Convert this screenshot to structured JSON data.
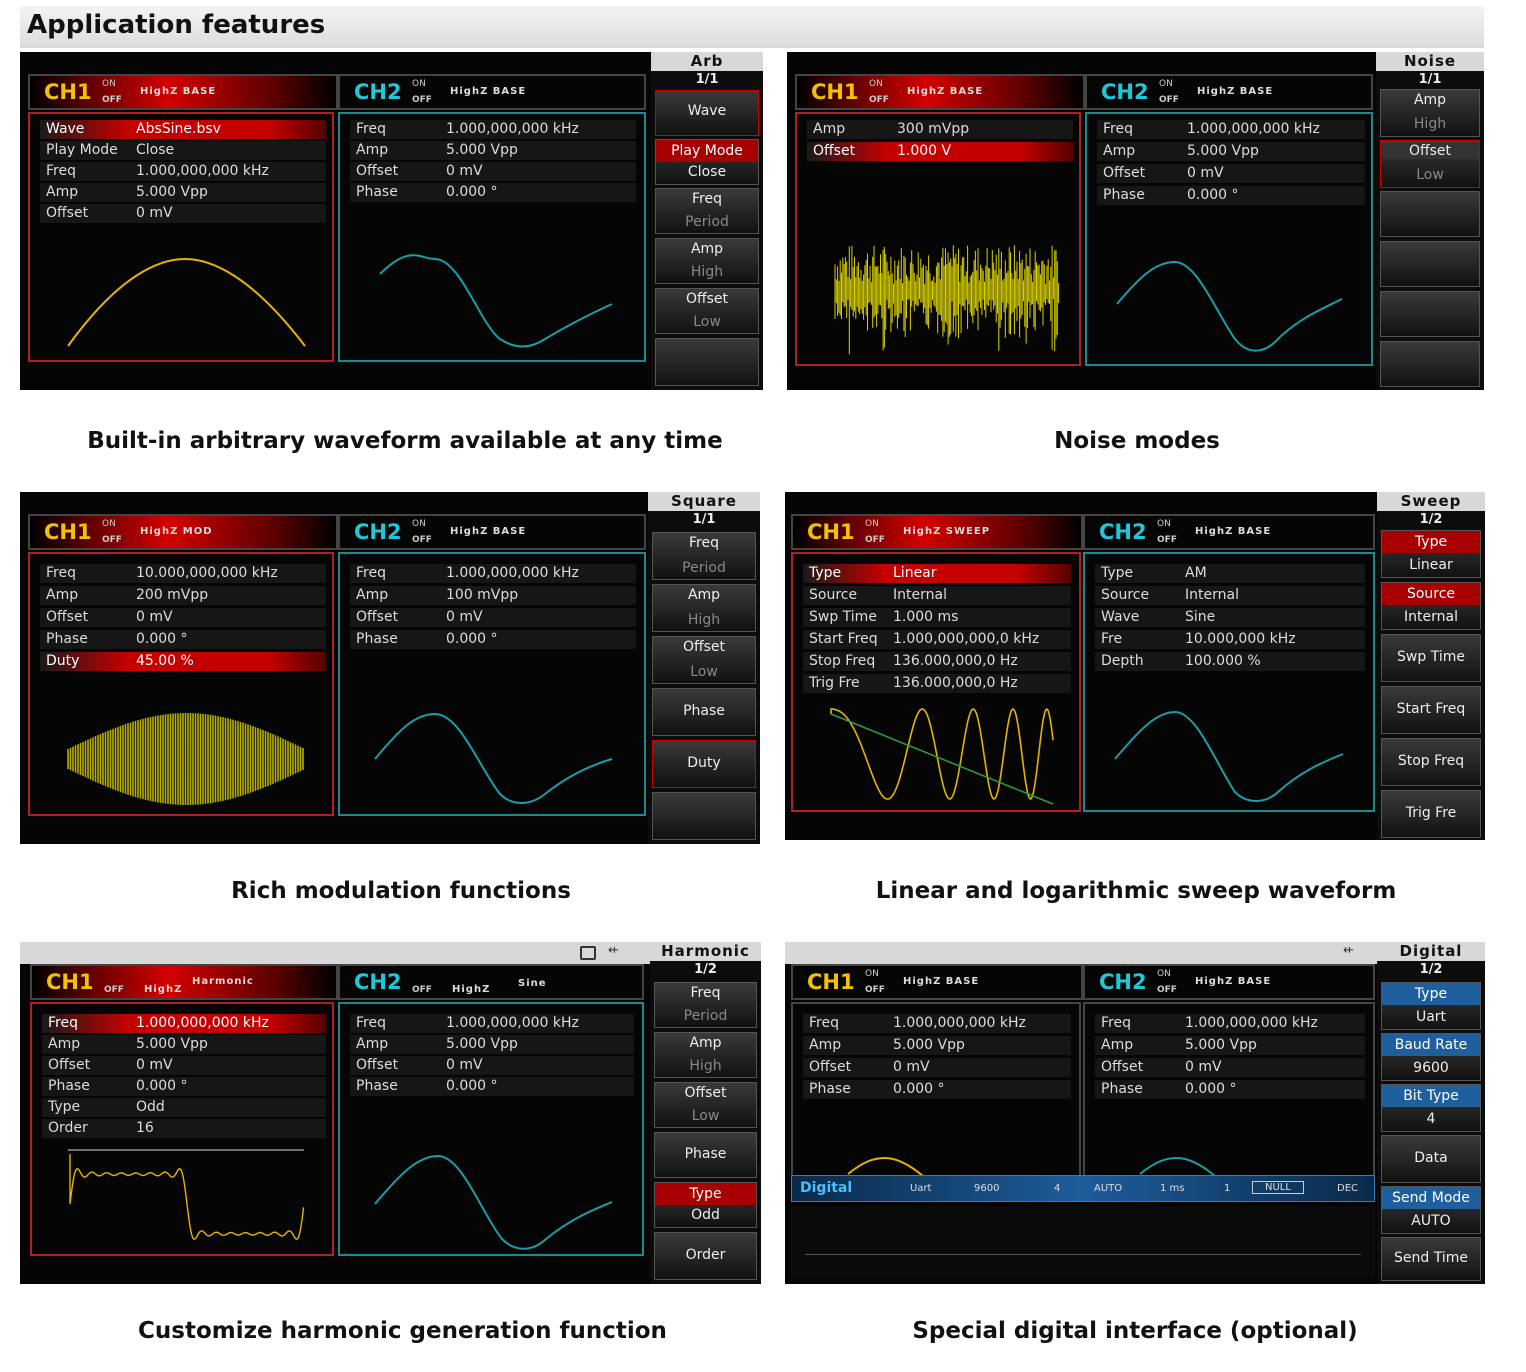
{
  "header": {
    "title": "Application features"
  },
  "captions": [
    "Built-in arbitrary waveform available at any time",
    "Noise modes",
    "Rich modulation functions",
    "Linear and logarithmic sweep waveform",
    "Customize harmonic generation function",
    "Special digital interface (optional)"
  ],
  "colors": {
    "ch1": "#f2c200",
    "ch2": "#1ec8d8",
    "active": "#c40000",
    "teal": "#1a8a8f"
  },
  "screens": [
    {
      "ch1": {
        "name": "CH1",
        "on": "ON",
        "off": "OFF",
        "mode": "HighZ BASE",
        "rows": [
          {
            "k": "Wave",
            "v": "AbsSine.bsv"
          },
          {
            "k": "Play Mode",
            "v": "Close"
          },
          {
            "k": "Freq",
            "v": "1.000,000,000 kHz"
          },
          {
            "k": "Amp",
            "v": "5.000 Vpp"
          },
          {
            "k": "Offset",
            "v": "0 mV"
          }
        ]
      },
      "ch2": {
        "name": "CH2",
        "on": "ON",
        "off": "OFF",
        "mode": "HighZ BASE",
        "rows": [
          {
            "k": "Freq",
            "v": "1.000,000,000 kHz"
          },
          {
            "k": "Amp",
            "v": "5.000 Vpp"
          },
          {
            "k": "Offset",
            "v": "0 mV"
          },
          {
            "k": "Phase",
            "v": "0.000 °"
          }
        ]
      },
      "menu": {
        "title": "Arb",
        "page": "1/1",
        "buttons": [
          {
            "a": "Wave"
          },
          {
            "a": "Play Mode",
            "b": "Close"
          },
          {
            "a": "Freq",
            "b": "Period"
          },
          {
            "a": "Amp",
            "b": "High"
          },
          {
            "a": "Offset",
            "b": "Low"
          },
          {
            "a": ""
          }
        ]
      }
    },
    {
      "ch1": {
        "name": "CH1",
        "on": "ON",
        "off": "OFF",
        "mode": "HighZ BASE",
        "rows": [
          {
            "k": "Amp",
            "v": "300 mVpp"
          },
          {
            "k": "Offset",
            "v": "1.000 V"
          }
        ]
      },
      "ch2": {
        "name": "CH2",
        "on": "ON",
        "off": "OFF",
        "mode": "HighZ BASE",
        "rows": [
          {
            "k": "Freq",
            "v": "1.000,000,000 kHz"
          },
          {
            "k": "Amp",
            "v": "5.000 Vpp"
          },
          {
            "k": "Offset",
            "v": "0 mV"
          },
          {
            "k": "Phase",
            "v": "0.000 °"
          }
        ]
      },
      "menu": {
        "title": "Noise",
        "page": "1/1",
        "buttons": [
          {
            "a": "Amp",
            "b": "High"
          },
          {
            "a": "Offset",
            "b": "Low"
          },
          {
            "a": ""
          },
          {
            "a": ""
          },
          {
            "a": ""
          },
          {
            "a": ""
          }
        ]
      }
    },
    {
      "ch1": {
        "name": "CH1",
        "on": "ON",
        "off": "OFF",
        "mode": "HighZ MOD",
        "rows": [
          {
            "k": "Freq",
            "v": "10.000,000,000 kHz"
          },
          {
            "k": "Amp",
            "v": "200 mVpp"
          },
          {
            "k": "Offset",
            "v": "0 mV"
          },
          {
            "k": "Phase",
            "v": "0.000 °"
          },
          {
            "k": "Duty",
            "v": "45.00 %"
          }
        ]
      },
      "ch2": {
        "name": "CH2",
        "on": "ON",
        "off": "OFF",
        "mode": "HighZ BASE",
        "rows": [
          {
            "k": "Freq",
            "v": "1.000,000,000 kHz"
          },
          {
            "k": "Amp",
            "v": "100 mVpp"
          },
          {
            "k": "Offset",
            "v": "0 mV"
          },
          {
            "k": "Phase",
            "v": "0.000 °"
          }
        ]
      },
      "menu": {
        "title": "Square",
        "page": "1/1",
        "buttons": [
          {
            "a": "Freq",
            "b": "Period"
          },
          {
            "a": "Amp",
            "b": "High"
          },
          {
            "a": "Offset",
            "b": "Low"
          },
          {
            "a": "Phase"
          },
          {
            "a": "Duty"
          },
          {
            "a": ""
          }
        ]
      }
    },
    {
      "ch1": {
        "name": "CH1",
        "on": "ON",
        "off": "OFF",
        "mode": "HighZ SWEEP",
        "rows": [
          {
            "k": "Type",
            "v": "Linear"
          },
          {
            "k": "Source",
            "v": "Internal"
          },
          {
            "k": "Swp Time",
            "v": "1.000 ms"
          },
          {
            "k": "Start Freq",
            "v": "1.000,000,000,0 kHz"
          },
          {
            "k": "Stop Freq",
            "v": "136.000,000,0 Hz"
          },
          {
            "k": "Trig Fre",
            "v": "136.000,000,0 Hz"
          }
        ]
      },
      "ch2": {
        "name": "CH2",
        "on": "ON",
        "off": "OFF",
        "mode": "HighZ BASE",
        "rows": [
          {
            "k": "Type",
            "v": "AM"
          },
          {
            "k": "Source",
            "v": "Internal"
          },
          {
            "k": "Wave",
            "v": "Sine"
          },
          {
            "k": "Fre",
            "v": "10.000,000 kHz"
          },
          {
            "k": "Depth",
            "v": "100.000 %"
          }
        ]
      },
      "menu": {
        "title": "Sweep",
        "page": "1/2",
        "buttons": [
          {
            "a": "Type",
            "b": "Linear"
          },
          {
            "a": "Source",
            "b": "Internal"
          },
          {
            "a": "Swp Time"
          },
          {
            "a": "Start Freq"
          },
          {
            "a": "Stop Freq"
          },
          {
            "a": "Trig Fre"
          }
        ]
      }
    },
    {
      "ch1": {
        "name": "CH1",
        "on": "",
        "off": "OFF",
        "mode": "HighZ",
        "mode2": "Harmonic",
        "rows": [
          {
            "k": "Freq",
            "v": "1.000,000,000 kHz"
          },
          {
            "k": "Amp",
            "v": "5.000 Vpp"
          },
          {
            "k": "Offset",
            "v": "0 mV"
          },
          {
            "k": "Phase",
            "v": "0.000 °"
          },
          {
            "k": "Type",
            "v": "Odd"
          },
          {
            "k": "Order",
            "v": "16"
          }
        ]
      },
      "ch2": {
        "name": "CH2",
        "on": "",
        "off": "OFF",
        "mode": "HighZ",
        "mode2": "Sine",
        "rows": [
          {
            "k": "Freq",
            "v": "1.000,000,000 kHz"
          },
          {
            "k": "Amp",
            "v": "5.000 Vpp"
          },
          {
            "k": "Offset",
            "v": "0 mV"
          },
          {
            "k": "Phase",
            "v": "0.000 °"
          }
        ]
      },
      "menu": {
        "title": "Harmonic",
        "page": "1/2",
        "buttons": [
          {
            "a": "Freq",
            "b": "Period"
          },
          {
            "a": "Amp",
            "b": "High"
          },
          {
            "a": "Offset",
            "b": "Low"
          },
          {
            "a": "Phase"
          },
          {
            "a": "Type",
            "b": "Odd"
          },
          {
            "a": "Order"
          }
        ]
      }
    },
    {
      "ch1": {
        "name": "CH1",
        "on": "ON",
        "off": "OFF",
        "mode": "HighZ BASE",
        "rows": [
          {
            "k": "Freq",
            "v": "1.000,000,000 kHz"
          },
          {
            "k": "Amp",
            "v": "5.000 Vpp"
          },
          {
            "k": "Offset",
            "v": "0 mV"
          },
          {
            "k": "Phase",
            "v": "0.000 °"
          }
        ]
      },
      "ch2": {
        "name": "CH2",
        "on": "ON",
        "off": "OFF",
        "mode": "HighZ BASE",
        "rows": [
          {
            "k": "Freq",
            "v": "1.000,000,000 kHz"
          },
          {
            "k": "Amp",
            "v": "5.000 Vpp"
          },
          {
            "k": "Offset",
            "v": "0 mV"
          },
          {
            "k": "Phase",
            "v": "0.000 °"
          }
        ]
      },
      "digital_bar": {
        "label": "Digital",
        "fields": [
          "Uart",
          "9600",
          "4",
          "AUTO",
          "1 ms",
          "1",
          "NULL",
          "DEC"
        ]
      },
      "menu": {
        "title": "Digital",
        "page": "1/2",
        "buttons": [
          {
            "a": "Type",
            "b": "Uart"
          },
          {
            "a": "Baud Rate",
            "b": "9600"
          },
          {
            "a": "Bit Type",
            "b": "4"
          },
          {
            "a": "Data"
          },
          {
            "a": "Send Mode",
            "b": "AUTO"
          },
          {
            "a": "Send Time"
          }
        ]
      }
    }
  ]
}
